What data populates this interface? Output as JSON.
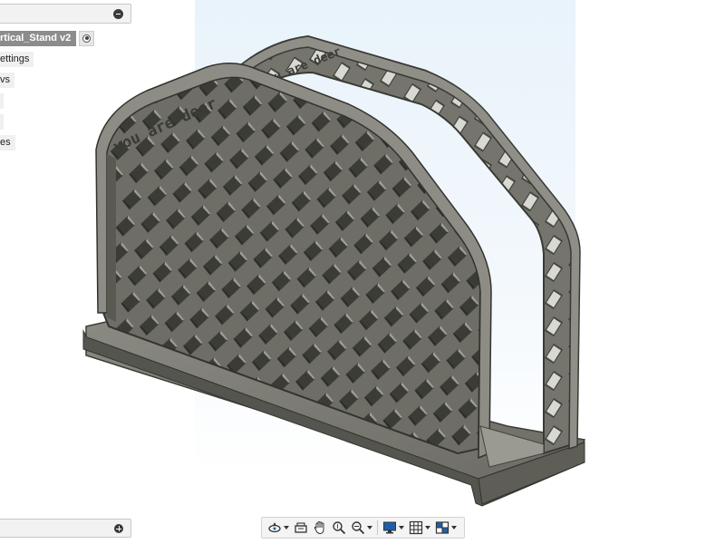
{
  "browser": {
    "root_label": "rtical_Stand v2",
    "items": [
      {
        "label": "ettings"
      },
      {
        "label": "vs"
      },
      {
        "label": ""
      },
      {
        "label": ""
      },
      {
        "label": "es"
      }
    ]
  },
  "model": {
    "front_engraving": "you are deer",
    "back_engraving": "you are deer"
  },
  "toolbar": {
    "buttons": [
      {
        "icon": "orbit-icon",
        "has_dropdown": true
      },
      {
        "icon": "look-at-icon",
        "has_dropdown": false
      },
      {
        "icon": "pan-hand-icon",
        "has_dropdown": false
      },
      {
        "icon": "zoom-icon",
        "has_dropdown": false
      },
      {
        "icon": "fit-zoom-icon",
        "has_dropdown": true
      },
      {
        "icon": "display-settings-icon",
        "has_dropdown": true
      },
      {
        "icon": "grid-icon",
        "has_dropdown": true
      },
      {
        "icon": "viewports-icon",
        "has_dropdown": true
      }
    ]
  },
  "colors": {
    "model_fill": "#707068",
    "model_dark": "#4a4a44",
    "model_light": "#9a9a92",
    "accent_blue": "#1f5fa8",
    "backplane": "#e9f3fb"
  }
}
